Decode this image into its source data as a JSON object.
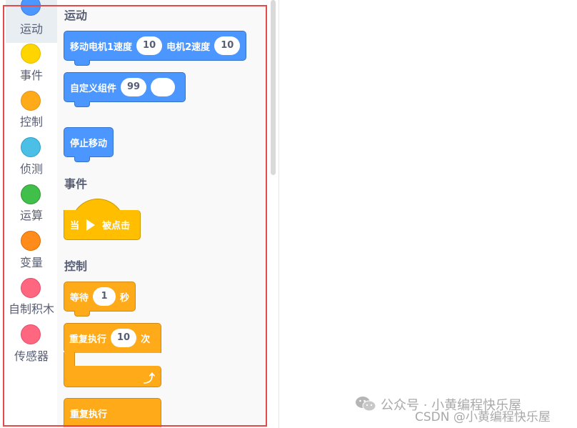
{
  "categories": [
    {
      "label": "运动",
      "color": "#4c97ff",
      "icon": "motion-dot-icon"
    },
    {
      "label": "事件",
      "color": "#ffd500",
      "icon": "event-dot-icon"
    },
    {
      "label": "控制",
      "color": "#ffab19",
      "icon": "control-dot-icon"
    },
    {
      "label": "侦测",
      "color": "#4cbfe6",
      "icon": "sensing-dot-icon"
    },
    {
      "label": "运算",
      "color": "#40bf4a",
      "icon": "operators-dot-icon"
    },
    {
      "label": "变量",
      "color": "#ff8c1a",
      "icon": "variables-dot-icon"
    },
    {
      "label": "自制积木",
      "color": "#ff6680",
      "icon": "my-blocks-dot-icon"
    },
    {
      "label": "传感器",
      "color": "#ff6680",
      "icon": "sensor-dot-icon"
    }
  ],
  "palette": {
    "motion": {
      "title": "运动",
      "motors_block": {
        "label1": "移动电机1速度",
        "value1": "10",
        "label2": "电机2速度",
        "value2": "10"
      },
      "custom_block": {
        "label": "自定义组件",
        "value": "99",
        "value2": ""
      },
      "stop_block": {
        "label": "停止移动"
      }
    },
    "events": {
      "title": "事件",
      "flag_block": {
        "label1": "当",
        "icon": "green-flag-icon",
        "label2": "被点击"
      }
    },
    "control": {
      "title": "控制",
      "wait_block": {
        "label1": "等待",
        "value": "1",
        "label2": "秒"
      },
      "repeat_block": {
        "label1": "重复执行",
        "value": "10",
        "label2": "次",
        "icon": "loop-arrow-icon"
      },
      "forever_block": {
        "label": "重复执行"
      }
    }
  },
  "colors": {
    "motion": "#4c97ff",
    "event": "#ffbf00",
    "control": "#ffab19",
    "highlight_frame": "#e44a4a"
  },
  "watermark": {
    "wechat": "公众号 · 小黄编程快乐屋",
    "csdn": "CSDN @小黄编程快乐屋",
    "icon": "wechat-icon"
  }
}
